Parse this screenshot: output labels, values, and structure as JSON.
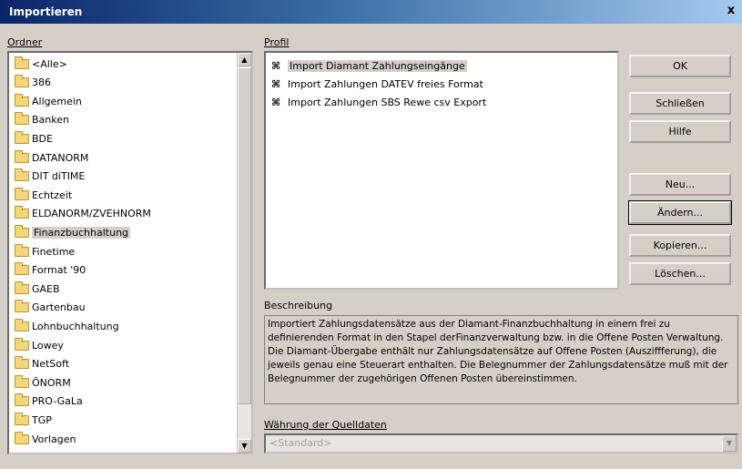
{
  "window": {
    "title": "Importieren",
    "close_label": "x"
  },
  "folders": {
    "label": "Ordner",
    "items": [
      "<Alle>",
      "386",
      "Allgemein",
      "Banken",
      "BDE",
      "DATANORM",
      "DIT diTIME",
      "Echtzeit",
      "ELDANORM/ZVEHNORM",
      "Finanzbuchhaltung",
      "Finetime",
      "Format '90",
      "GAEB",
      "Gartenbau",
      "Lohnbuchhaltung",
      "Lowey",
      "NetSoft",
      "ÖNORM",
      "PRO-GaLa",
      "TGP",
      "Vorlagen"
    ],
    "selected_index": 9
  },
  "profiles": {
    "label": "Profil",
    "items": [
      "Import  Diamant Zahlungseingänge",
      "Import Zahlungen DATEV freies Format",
      "Import Zahlungen SBS Rewe csv Export"
    ],
    "selected_index": 0,
    "icon": "profile-icon"
  },
  "buttons": {
    "ok": "OK",
    "close": "Schließen",
    "help": "Hilfe",
    "new": "Neu...",
    "edit": "Ändern...",
    "copy": "Kopieren...",
    "delete": "Löschen..."
  },
  "description": {
    "label": "Beschreibung",
    "text": "Importiert Zahlungsdatensätze aus der Diamant-Finanzbuchhaltung in einem frei zu definierenden Format in den Stapel derFinanzverwaltung bzw. in die Offene Posten Verwaltung. Die Diamant-Übergabe enthält nur Zahlungsdatensätze auf Offene Posten (Ausziffferung), die jeweils genau eine Steuerart enthalten. Die Belegnummer der Zahlungsdatensätze muß mit der Belegnummer der zugehörigen Offenen Posten übereinstimmen."
  },
  "currency": {
    "label": "Währung der Quelldaten",
    "value": "<Standard>"
  }
}
